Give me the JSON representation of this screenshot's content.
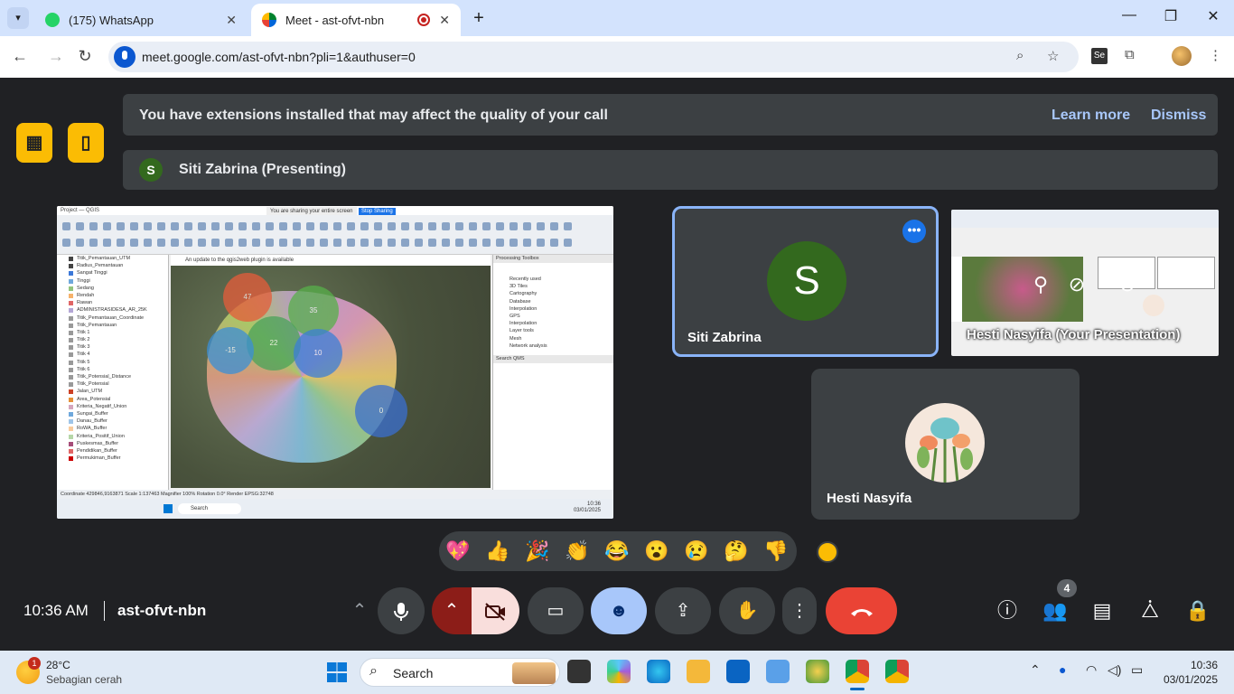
{
  "browser": {
    "tabs": [
      {
        "title": "(175) WhatsApp"
      },
      {
        "title": "Meet - ast-ofvt-nbn"
      }
    ],
    "url": "meet.google.com/ast-ofvt-nbn?pli=1&authuser=0",
    "extension_label": "Se"
  },
  "banner": {
    "message": "You have extensions installed that may affect the quality of your call",
    "learn_more": "Learn more",
    "dismiss": "Dismiss"
  },
  "presenting": {
    "initial": "S",
    "label": "Siti Zabrina (Presenting)"
  },
  "shared_screen": {
    "window_title": "Project — QGIS",
    "share_notice": "You are sharing your entire screen",
    "stop_label": "Stop Sharing",
    "update_notice": "An update to the qgis2web plugin is available",
    "layers": [
      {
        "name": "Titik_Pemantauan_UTM",
        "color": "#444"
      },
      {
        "name": "Radius_Pemantauan",
        "color": "#444"
      },
      {
        "name": "Sangat Tinggi",
        "color": "#3c78d8"
      },
      {
        "name": "Tinggi",
        "color": "#6fa8dc"
      },
      {
        "name": "Sedang",
        "color": "#93c47d"
      },
      {
        "name": "Rendah",
        "color": "#f6b26b"
      },
      {
        "name": "Rawan",
        "color": "#e06666"
      },
      {
        "name": "ADMINISTRASIDESA_AR_25K",
        "color": "#b4a7d6"
      },
      {
        "name": "Titik_Pemantauan_Coordinate",
        "color": "#999"
      },
      {
        "name": "Titik_Pemantauan",
        "color": "#999"
      },
      {
        "name": "Titik 1",
        "color": "#999"
      },
      {
        "name": "Titik 2",
        "color": "#999"
      },
      {
        "name": "Titik 3",
        "color": "#999"
      },
      {
        "name": "Titik 4",
        "color": "#999"
      },
      {
        "name": "Titik 5",
        "color": "#999"
      },
      {
        "name": "Titik 6",
        "color": "#999"
      },
      {
        "name": "Titik_Potensial_Distance",
        "color": "#999"
      },
      {
        "name": "Titik_Potensial",
        "color": "#999"
      },
      {
        "name": "Jalan_UTM",
        "color": "#cc4125"
      },
      {
        "name": "Area_Potensial",
        "color": "#e69138"
      },
      {
        "name": "Kriteria_Negatif_Union",
        "color": "#d5a6bd"
      },
      {
        "name": "Sungai_Buffer",
        "color": "#6fa8dc"
      },
      {
        "name": "Danau_Buffer",
        "color": "#9fc5e8"
      },
      {
        "name": "RoWA_Buffer",
        "color": "#f9cb9c"
      },
      {
        "name": "Kriteria_Positif_Union",
        "color": "#b6d7a8"
      },
      {
        "name": "Puskesmas_Buffer",
        "color": "#a64d79"
      },
      {
        "name": "Pendidikan_Buffer",
        "color": "#e06666"
      },
      {
        "name": "Permukiman_Buffer",
        "color": "#cc0000"
      }
    ],
    "buffers": [
      {
        "label": "47",
        "color": "#e65c3a"
      },
      {
        "label": "35",
        "color": "#57b04a"
      },
      {
        "label": "22",
        "color": "#4aa35a"
      },
      {
        "label": "-15",
        "color": "#3b8fd6"
      },
      {
        "label": "10",
        "color": "#3b7fd6"
      },
      {
        "label": "0",
        "color": "#3a6fd0"
      }
    ],
    "toolbox_title": "Processing Toolbox",
    "toolbox_items": [
      "Recently used",
      "3D Tiles",
      "Cartography",
      "Database",
      "Interpolation",
      "GPS",
      "Interpolation",
      "Layer tools",
      "Mesh",
      "Network analysis"
    ],
    "search_label": "Search QMS",
    "status": "Coordinate 429846,9163871   Scale 1:137463   Magnifier 100%   Rotation 0.0°   Render   EPSG:32748",
    "taskbar_search": "Search",
    "taskbar_time": "10:36",
    "taskbar_date": "03/01/2025"
  },
  "participants": [
    {
      "initial": "S",
      "name": "Siti Zabrina"
    },
    {
      "name": "Hesti Nasyifa (Your Presentation)"
    },
    {
      "name": "Hesti Nasyifa"
    }
  ],
  "reactions": [
    "💖",
    "👍",
    "🎉",
    "👏",
    "😂",
    "😮",
    "😢",
    "🤔",
    "👎"
  ],
  "footer": {
    "time": "10:36 AM",
    "meeting_code": "ast-ofvt-nbn",
    "people_count": "4"
  },
  "taskbar": {
    "notification_count": "1",
    "temperature": "28°C",
    "weather": "Sebagian cerah",
    "search": "Search",
    "time": "10:36",
    "date": "03/01/2025"
  }
}
